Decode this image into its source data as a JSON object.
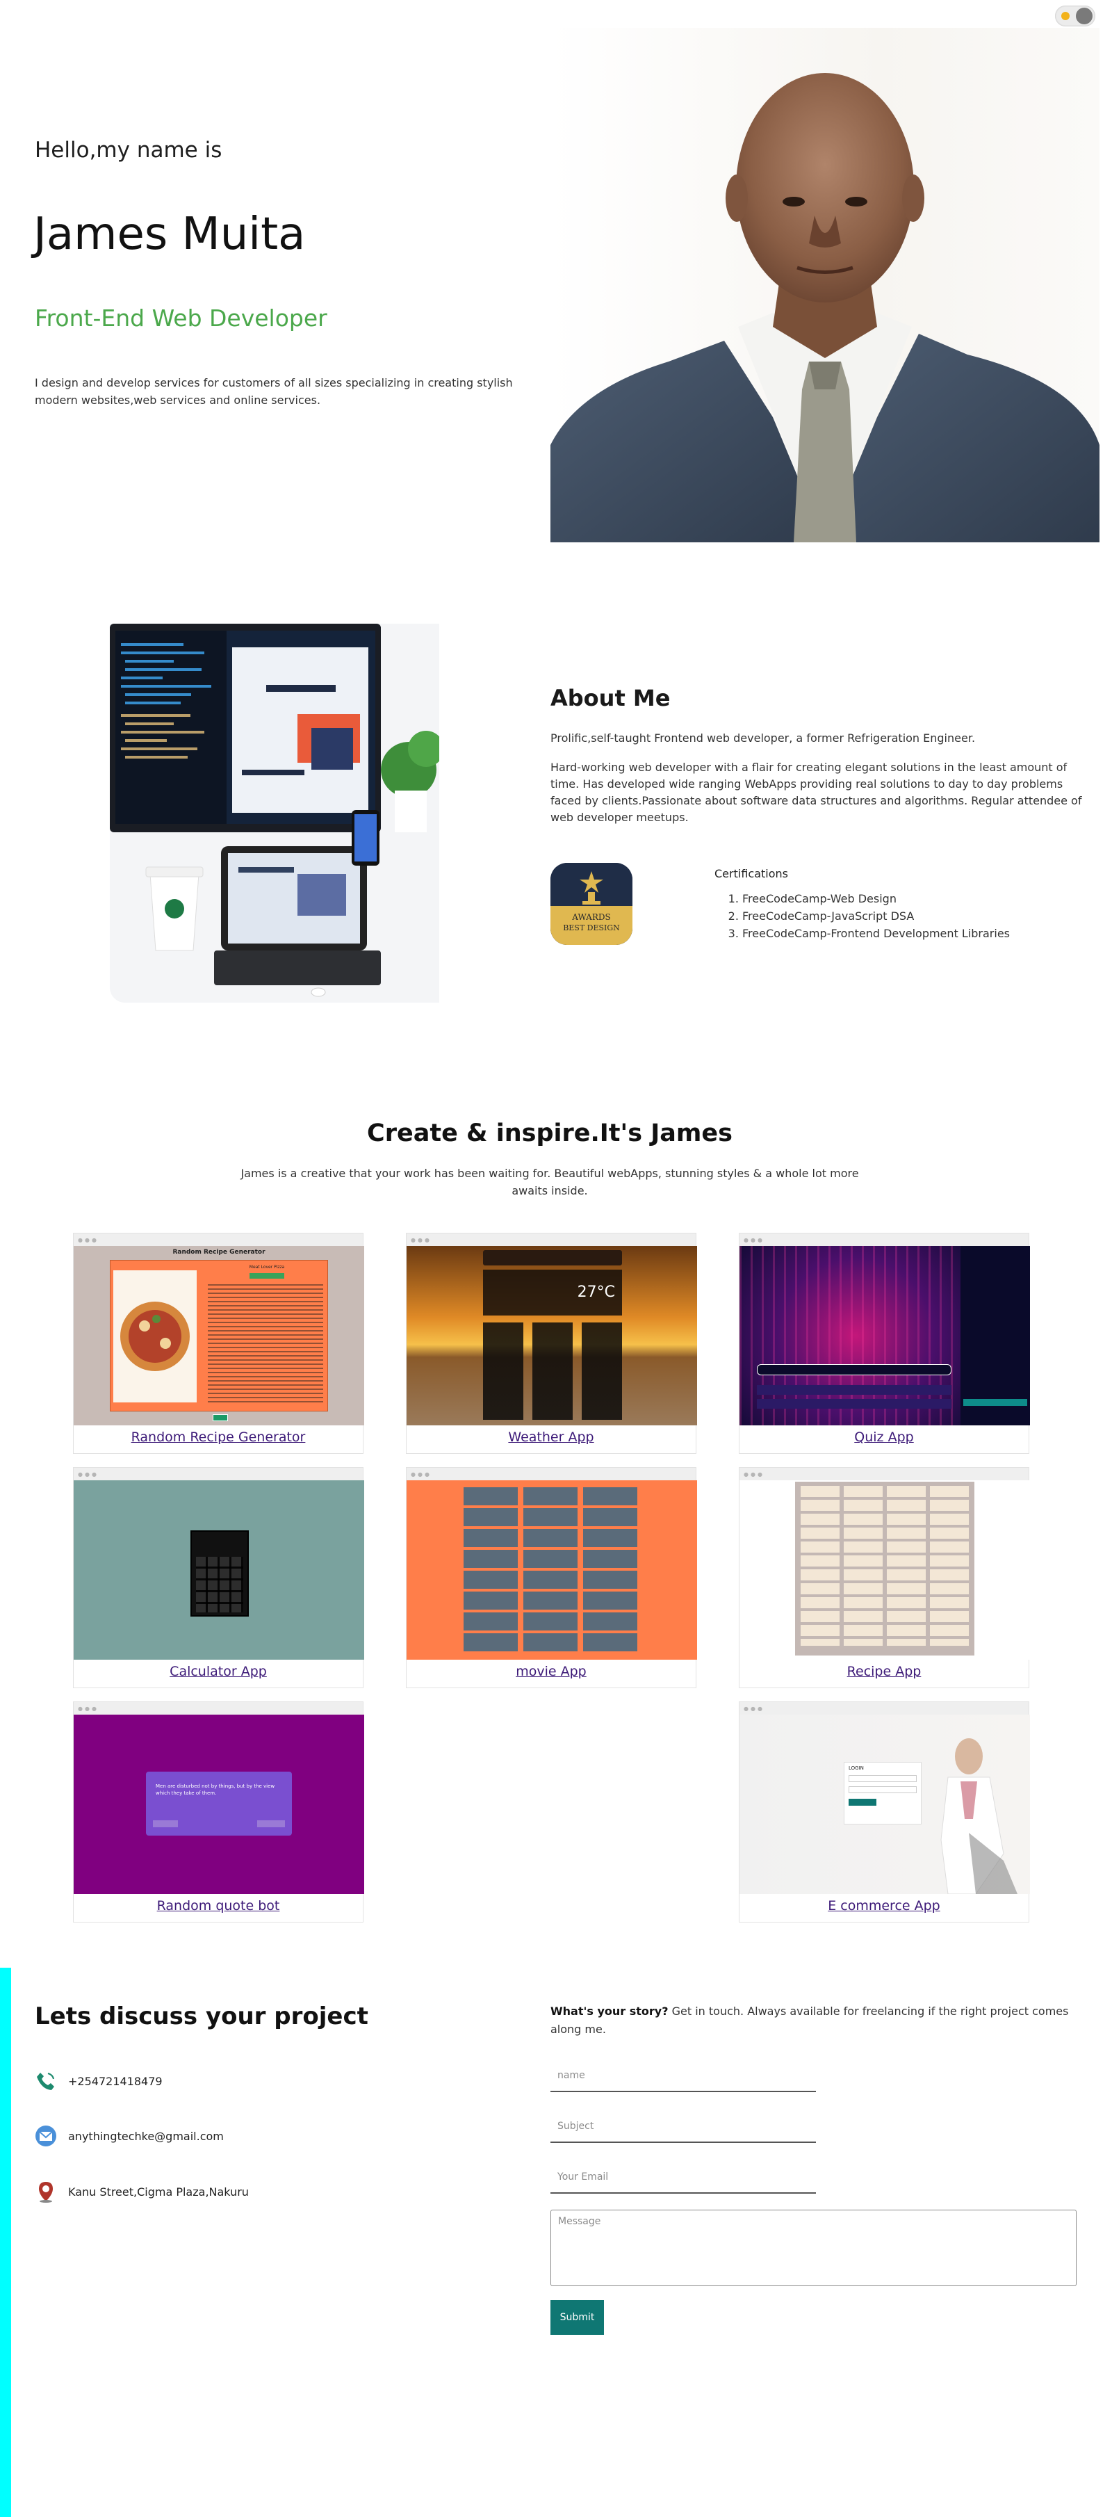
{
  "theme_toggle": {
    "icon": "sun-icon"
  },
  "hero": {
    "greeting": "Hello,my name is",
    "name": "James Muita",
    "role": "Front-End Web Developer",
    "intro": "I design and develop services for customers of all sizes specializing in creating stylish modern websites,web services and online services."
  },
  "about": {
    "title": "About Me",
    "paragraph1": "Prolific,self-taught Frontend web developer, a former Refrigeration Engineer.",
    "paragraph2": "Hard-working web developer with a flair for creating elegant solutions in the least amount of time. Has developed wide ranging WebApps providing real solutions to day to day problems faced by clients.Passionate about software data structures and algorithms. Regular attendee of web developer meetups.",
    "award_badge_lines": [
      "AWARDS",
      "BEST DESIGN"
    ],
    "certifications_title": "Certifications",
    "certifications": [
      "FreeCodeCamp-Web Design",
      "FreeCodeCamp-JavaScript DSA",
      "FreeCodeCamp-Frontend Development Libraries"
    ]
  },
  "projects": {
    "title": "Create & inspire.It's James",
    "subtitle": "James is a creative that your work has been waiting for. Beautiful webApps, stunning styles & a whole lot more awaits inside.",
    "items": [
      {
        "label": "Random Recipe Generator"
      },
      {
        "label": "Weather App"
      },
      {
        "label": "Quiz App"
      },
      {
        "label": "Calculator App"
      },
      {
        "label": "movie App"
      },
      {
        "label": "Recipe App"
      },
      {
        "label": "Random quote bot"
      },
      {
        "label": "E commerce App"
      }
    ],
    "screens": {
      "recipe_gen_title": "Random Recipe Generator",
      "recipe_gen_subtitle": "Meat Lover Pizza",
      "weather_temp": "27°C",
      "quote_text": "Men are disturbed not by things, but by the view which they take of them.",
      "ecommerce_form_title": "LOGIN"
    }
  },
  "contact": {
    "title": "Lets discuss your project",
    "phone": "+254721418479",
    "email": "anythingtechke@gmail.com",
    "address": "Kanu Street,Cigma Plaza,Nakuru",
    "story_bold": "What's your story?",
    "story_text": " Get in touch. Always available for freelancing if the right project comes along me.",
    "form": {
      "name_placeholder": "name",
      "subject_placeholder": "Subject",
      "email_placeholder": "Your Email",
      "message_placeholder": "Message",
      "submit_label": "Submit"
    }
  },
  "colors": {
    "accent_green": "#4ba84b",
    "link_purple": "#3d1a78",
    "submit_teal": "#0f7773",
    "strip_cyan": "#00ffff"
  }
}
